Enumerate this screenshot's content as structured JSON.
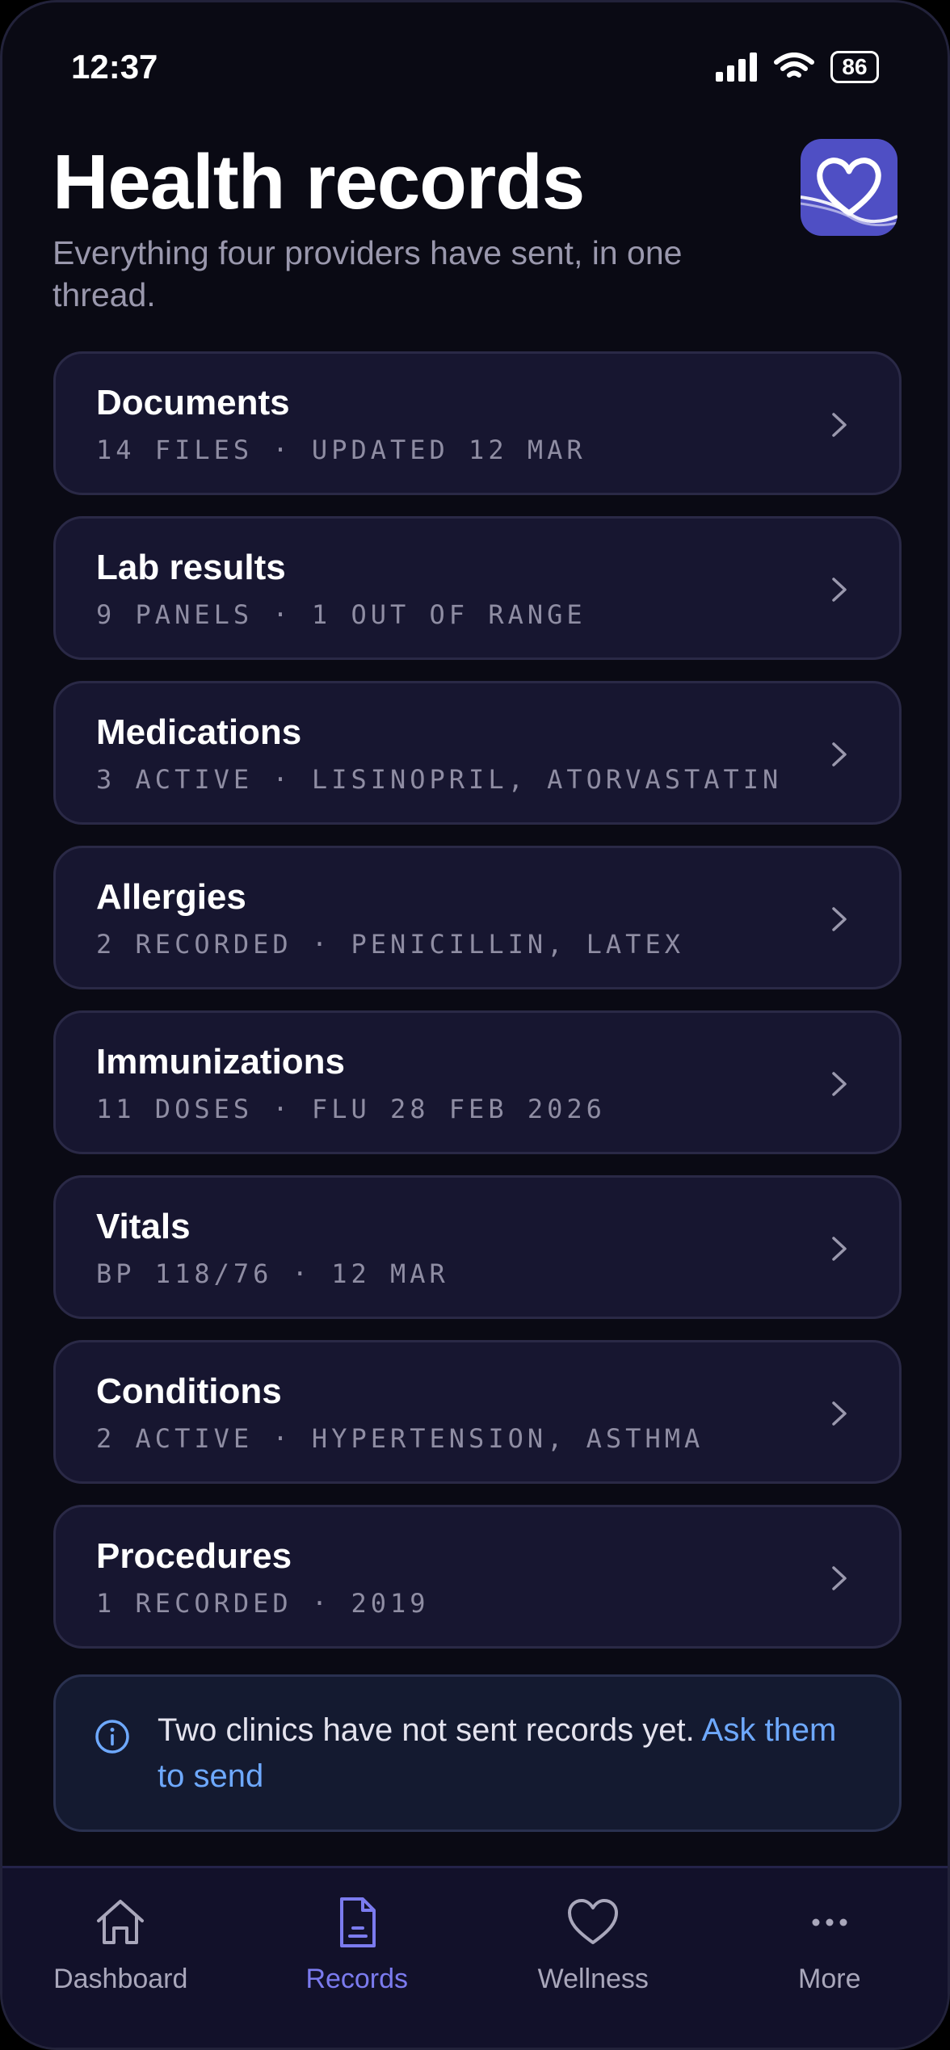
{
  "status_bar": {
    "time": "12:37",
    "battery": "86"
  },
  "header": {
    "title": "Health records",
    "subtitle": "Everything four providers have sent, in one thread."
  },
  "records": [
    {
      "title": "Documents",
      "meta": "14 FILES · UPDATED 12 MAR"
    },
    {
      "title": "Lab results",
      "meta": "9 PANELS · 1 OUT OF RANGE"
    },
    {
      "title": "Medications",
      "meta": "3 ACTIVE · LISINOPRIL, ATORVASTATIN"
    },
    {
      "title": "Allergies",
      "meta": "2 RECORDED · PENICILLIN, LATEX"
    },
    {
      "title": "Immunizations",
      "meta": "11 DOSES · FLU 28 FEB 2026"
    },
    {
      "title": "Vitals",
      "meta": "BP 118/76 · 12 MAR"
    },
    {
      "title": "Conditions",
      "meta": "2 ACTIVE · HYPERTENSION, ASTHMA"
    },
    {
      "title": "Procedures",
      "meta": "1 RECORDED · 2019"
    }
  ],
  "notice": {
    "text": "Two clinics have not sent records yet. ",
    "link": "Ask them to send"
  },
  "tabs": [
    {
      "label": "Dashboard",
      "icon": "home-icon",
      "active": false
    },
    {
      "label": "Records",
      "icon": "document-icon",
      "active": true
    },
    {
      "label": "Wellness",
      "icon": "heart-icon",
      "active": false
    },
    {
      "label": "More",
      "icon": "more-icon",
      "active": false
    }
  ],
  "colors": {
    "background": "#0a0a14",
    "card": "#171630",
    "accent": "#7b7bef",
    "link": "#6ea9ff",
    "logo": "#4f4fc4"
  }
}
